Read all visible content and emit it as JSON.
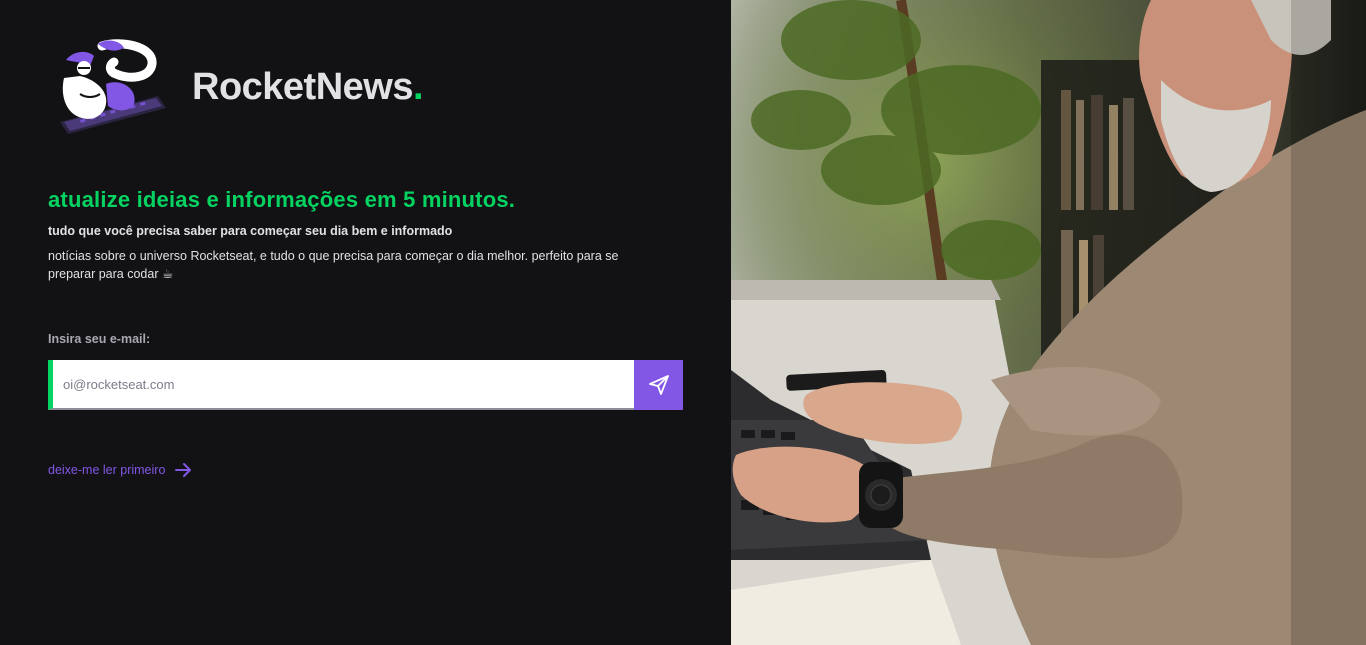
{
  "brand": {
    "name": "RocketNews",
    "dot": ".",
    "accent_color": "#04d361"
  },
  "hero": {
    "headline": "atualize ideias e informações em 5 minutos.",
    "subheadline": "tudo que você precisa saber para começar seu dia bem e informado",
    "description": "notícias sobre o universo Rocketseat, e tudo o que precisa para começar o dia melhor. perfeito para se preparar para codar ☕"
  },
  "form": {
    "email_label": "Insira seu e-mail:",
    "email_placeholder": "oi@rocketseat.com",
    "submit_icon": "send-icon"
  },
  "links": {
    "read_first": "deixe-me ler primeiro",
    "read_first_icon": "arrow-right-icon"
  },
  "colors": {
    "background": "#121214",
    "green": "#04d361",
    "purple": "#8257e5",
    "text": "#e1e1e6"
  },
  "photo": {
    "subject": "man with beard typing on laptop"
  }
}
